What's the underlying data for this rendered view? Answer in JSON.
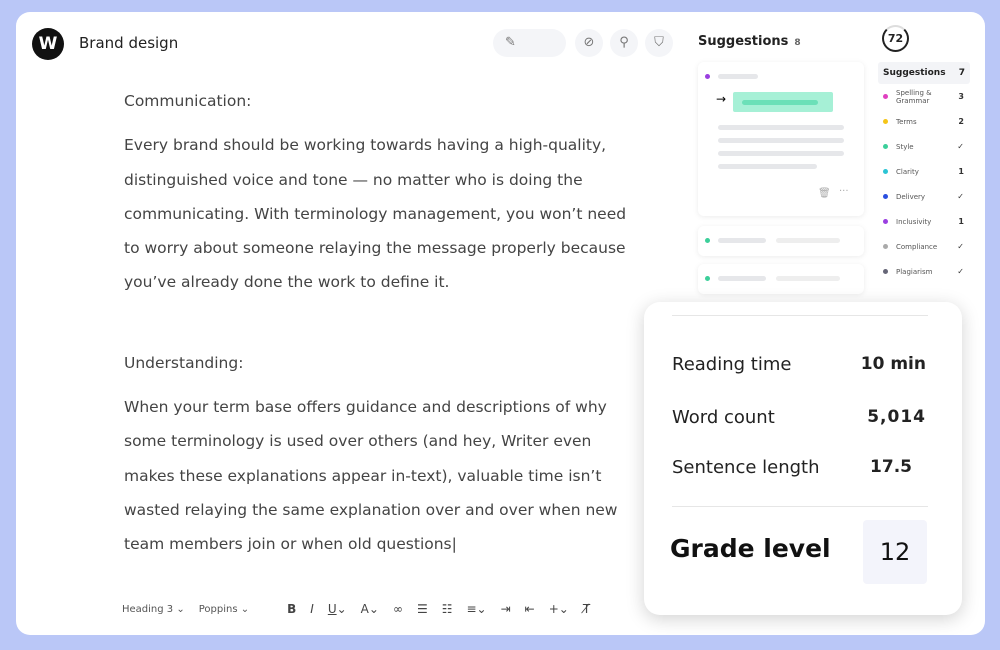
{
  "header": {
    "logo": "W",
    "title": "Brand design"
  },
  "toolbar": {
    "icons": [
      "magic-wand-icon",
      "link-icon",
      "pin-icon",
      "shield-check-icon"
    ]
  },
  "document": {
    "paragraphs": [
      "Communication:",
      "Every brand should be working towards having a high-quality, distinguished voice and tone — no matter who is doing the communicating. With terminology management, you won’t need to worry about someone relaying the message properly because you’ve already done the work to define it.",
      "Understanding:",
      "When your term base offers guidance and descriptions of why some terminology is used over others (and hey, Writer even makes these explanations appear in-text), valuable time isn’t wasted relaying the same explanation over and over when new team members join or when old questions|"
    ]
  },
  "format_bar": {
    "style": "Heading 3",
    "font": "Poppins"
  },
  "suggestions_panel": {
    "title": "Suggestions",
    "count": "8"
  },
  "score": "72",
  "categories": {
    "title": "Suggestions",
    "count": "7",
    "items": [
      {
        "label": "Spelling & Grammar",
        "value": "3",
        "color": "#e040c0"
      },
      {
        "label": "Terms",
        "value": "2",
        "color": "#f5c518"
      },
      {
        "label": "Style",
        "value": "✓",
        "color": "#3ccf9a"
      },
      {
        "label": "Clarity",
        "value": "1",
        "color": "#2bc4d4"
      },
      {
        "label": "Delivery",
        "value": "✓",
        "color": "#2a4fe0"
      },
      {
        "label": "Inclusivity",
        "value": "1",
        "color": "#9a3fe0"
      },
      {
        "label": "Compliance",
        "value": "✓",
        "color": "#aaaaaa"
      },
      {
        "label": "Plagiarism",
        "value": "✓",
        "color": "#666677"
      }
    ]
  },
  "stats": {
    "reading_time_label": "Reading time",
    "reading_time": "10 min",
    "word_count_label": "Word count",
    "word_count": "5,014",
    "sentence_length_label": "Sentence length",
    "sentence_length": "17.5",
    "grade_label": "Grade level",
    "grade": "12"
  }
}
